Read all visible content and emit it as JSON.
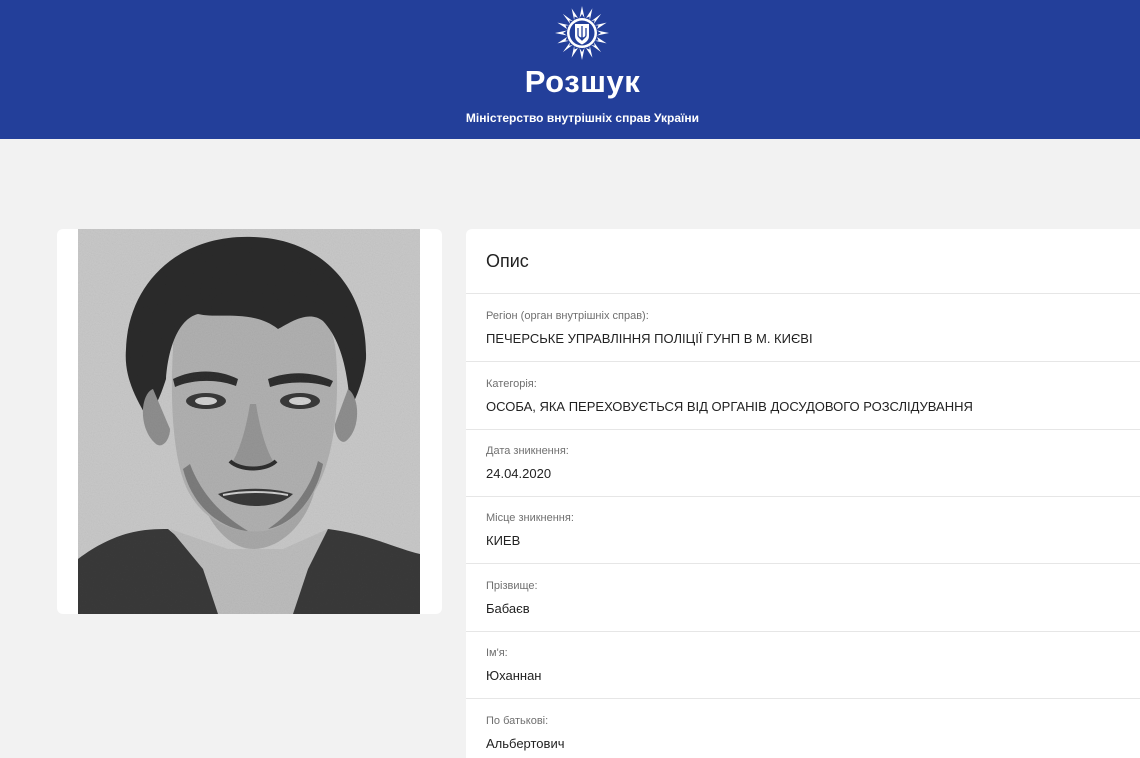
{
  "header": {
    "title": "Розшук",
    "subtitle": "Міністерство внутрішніх справ України",
    "emblem_icon": "police-star-emblem-icon",
    "background_color": "#233f9a"
  },
  "photo": {
    "icon": "suspect-sketch-portrait"
  },
  "info": {
    "title": "Опис",
    "fields": [
      {
        "label": "Регіон (орган внутрішніх справ):",
        "value": "ПЕЧЕРСЬКЕ УПРАВЛІННЯ ПОЛІЦІЇ ГУНП В М. КИЄВІ"
      },
      {
        "label": "Категорія:",
        "value": "ОСОБА, ЯКА ПЕРЕХОВУЄТЬСЯ ВІД ОРГАНІВ ДОСУДОВОГО РОЗСЛІДУВАННЯ"
      },
      {
        "label": "Дата зникнення:",
        "value": "24.04.2020"
      },
      {
        "label": "Місце зникнення:",
        "value": "КИЕВ"
      },
      {
        "label": "Прізвище:",
        "value": "Бабаєв"
      },
      {
        "label": "Ім'я:",
        "value": "Юханнан"
      },
      {
        "label": "По батькові:",
        "value": "Альбертович"
      }
    ]
  }
}
